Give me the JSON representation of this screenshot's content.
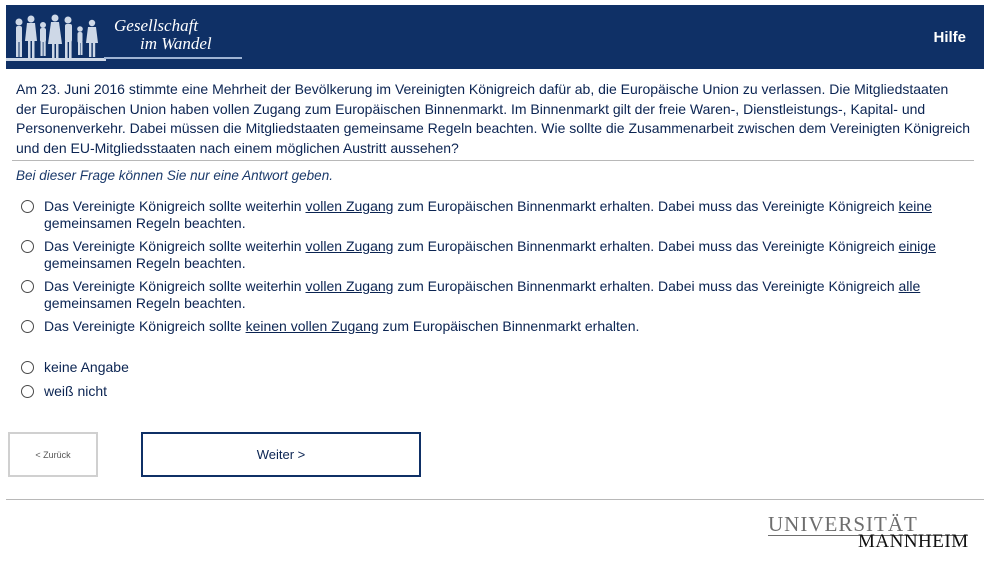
{
  "header": {
    "logo_line1": "Gesellschaft",
    "logo_line2": "im Wandel",
    "help_label": "Hilfe"
  },
  "question": {
    "text": "Am 23. Juni 2016 stimmte eine Mehrheit der Bevölkerung im Vereinigten Königreich dafür ab, die Europäische Union zu verlassen. Die Mitgliedstaaten der Europäischen Union haben vollen Zugang zum Europäischen Binnenmarkt. Im Binnenmarkt gilt der freie Waren-, Dienstleistungs-, Kapital- und Personenverkehr. Dabei müssen die Mitgliedstaaten gemeinsame Regeln beachten. Wie sollte die Zusammenarbeit zwischen dem Vereinigten Königreich und den EU-Mitgliedsstaaten nach einem möglichen Austritt aussehen?",
    "instruction": "Bei dieser Frage können Sie nur eine Antwort geben."
  },
  "options": [
    {
      "pre": "Das Vereinigte Königreich sollte weiterhin ",
      "u1": "vollen Zugang",
      "mid": " zum Europäischen Binnenmarkt erhalten. Dabei muss das Vereinigte Königreich ",
      "u2": "keine",
      "post": " gemeinsamen Regeln beachten."
    },
    {
      "pre": "Das Vereinigte Königreich sollte weiterhin ",
      "u1": "vollen Zugang",
      "mid": " zum Europäischen Binnenmarkt erhalten. Dabei muss das Vereinigte Königreich ",
      "u2": "einige",
      "post": " gemeinsamen Regeln beachten."
    },
    {
      "pre": "Das Vereinigte Königreich sollte weiterhin ",
      "u1": "vollen Zugang",
      "mid": " zum Europäischen Binnenmarkt erhalten. Dabei muss das Vereinigte Königreich ",
      "u2": "alle",
      "post": " gemeinsamen Regeln beachten."
    },
    {
      "pre": "Das Vereinigte Königreich sollte ",
      "u1": "keinen vollen Zugang",
      "post": " zum Europäischen Binnenmarkt erhalten."
    },
    {
      "label": "keine Angabe"
    },
    {
      "label": "weiß nicht"
    }
  ],
  "nav": {
    "back_label": "< Zurück",
    "next_label": "Weiter >"
  },
  "footer": {
    "uni_line1": "UNIVERSITÄT",
    "uni_line2": "MANNHEIM"
  },
  "colors": {
    "header_bg": "#0f3066",
    "text": "#0b2452",
    "divider": "#b8b8b8"
  }
}
